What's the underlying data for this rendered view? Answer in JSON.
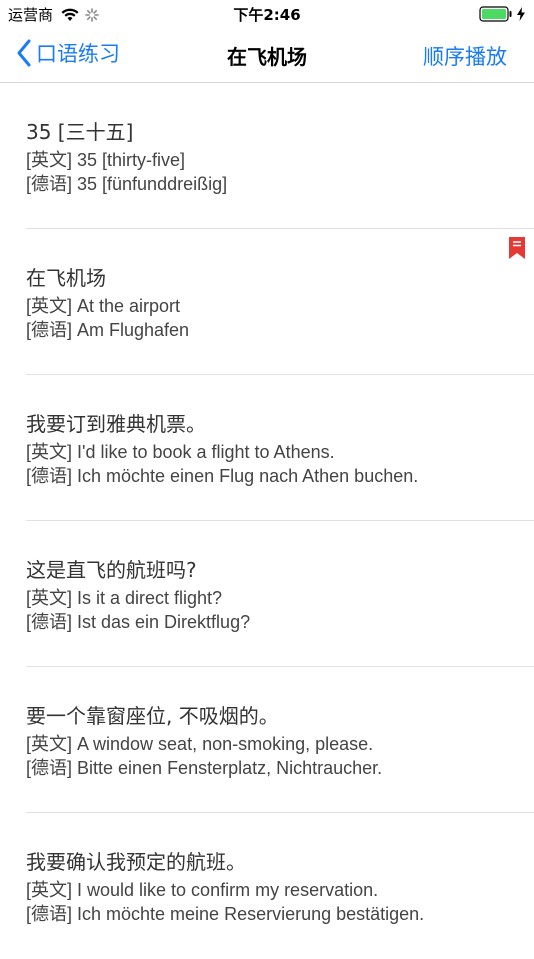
{
  "status_bar": {
    "carrier": "运营商",
    "time": "下午2:46"
  },
  "nav": {
    "back_label": "口语练习",
    "title": "在飞机场",
    "action_label": "顺序播放"
  },
  "phrases": [
    {
      "zh": "35 [三十五]",
      "en": "[英文] 35 [thirty-five]",
      "de": "[德语] 35 [fünfunddreißig]",
      "bookmarked": false
    },
    {
      "zh": "在飞机场",
      "en": "[英文] At the airport",
      "de": "[德语] Am Flughafen",
      "bookmarked": true
    },
    {
      "zh": "我要订到雅典机票。",
      "en": "[英文] I'd like to book a flight to Athens.",
      "de": "[德语] Ich möchte einen Flug nach Athen buchen.",
      "bookmarked": false
    },
    {
      "zh": "这是直飞的航班吗?",
      "en": "[英文] Is it a direct flight?",
      "de": "[德语] Ist das ein Direktflug?",
      "bookmarked": false
    },
    {
      "zh": "要一个靠窗座位, 不吸烟的。",
      "en": "[英文] A window seat, non-smoking, please.",
      "de": "[德语] Bitte einen Fensterplatz, Nichtraucher.",
      "bookmarked": false
    },
    {
      "zh": "我要确认我预定的航班。",
      "en": "[英文] I would like to confirm my reservation.",
      "de": "[德语] Ich möchte meine Reservierung bestätigen.",
      "bookmarked": false
    }
  ],
  "colors": {
    "accent": "#1a7cf5",
    "bookmark": "#e53935"
  }
}
